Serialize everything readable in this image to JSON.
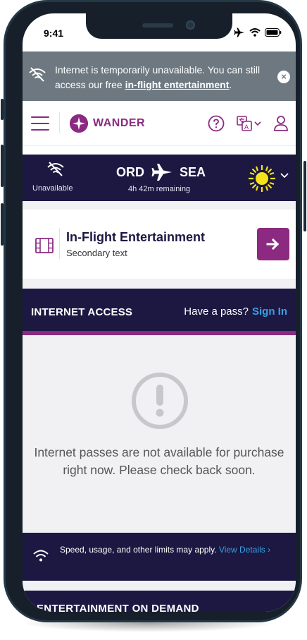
{
  "status_bar": {
    "time": "9:41"
  },
  "banner": {
    "message": "Internet is temporarily unavailable. You can still access our free ",
    "link": "in-flight entertainment",
    "suffix": "."
  },
  "header": {
    "brand": "WANDER"
  },
  "flight": {
    "origin": "ORD",
    "destination": "SEA",
    "connection_status": "Unavailable",
    "remaining": "4h 42m remaining"
  },
  "entertainment_card": {
    "title": "In-Flight Entertainment",
    "subtitle": "Secondary text"
  },
  "internet_access": {
    "title": "INTERNET ACCESS",
    "have_pass": "Have a pass?",
    "sign_in": "Sign In"
  },
  "empty_state": {
    "message": "Internet passes are not available for purchase right now. Please check back soon."
  },
  "limits": {
    "text": "Speed, usage, and other limits may apply.",
    "link": "View Details ›"
  },
  "next_section": {
    "title": "ENTERTAINMENT ON DEMAND"
  },
  "colors": {
    "brand": "#8b2a80",
    "navy": "#1c1842",
    "banner_gray": "#6d7880",
    "link_blue": "#3aa0e6"
  }
}
